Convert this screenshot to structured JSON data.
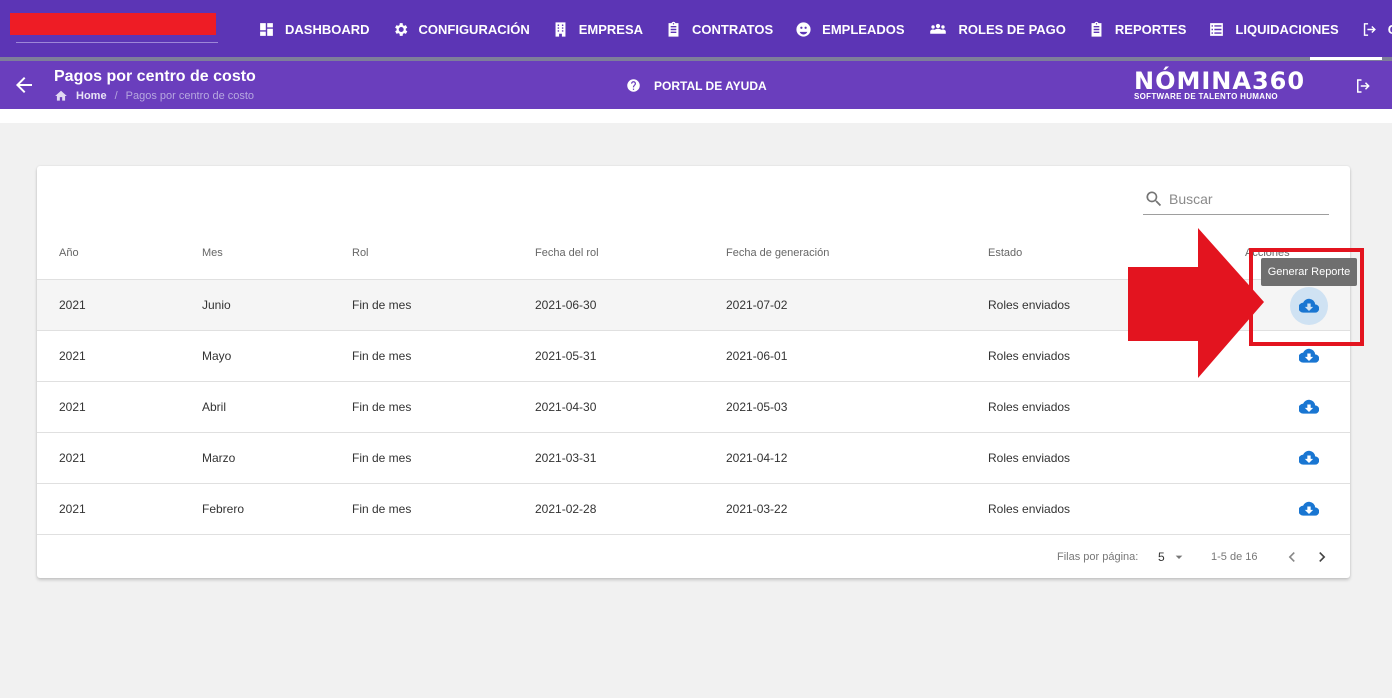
{
  "nav": {
    "items": [
      {
        "label": "DASHBOARD",
        "icon": "dashboard-icon"
      },
      {
        "label": "CONFIGURACIÓN",
        "icon": "gear-icon"
      },
      {
        "label": "EMPRESA",
        "icon": "building-icon"
      },
      {
        "label": "CONTRATOS",
        "icon": "clipboard-icon"
      },
      {
        "label": "EMPLEADOS",
        "icon": "users-icon"
      },
      {
        "label": "ROLES DE PAGO",
        "icon": "group-icon"
      },
      {
        "label": "REPORTES",
        "icon": "report-icon"
      },
      {
        "label": "LIQUIDACIONES",
        "icon": "list-icon"
      },
      {
        "label": "CE",
        "icon": "exit-icon"
      }
    ]
  },
  "header": {
    "title": "Pagos por centro de costo",
    "breadcrumb_home": "Home",
    "breadcrumb_separator": "/",
    "breadcrumb_current": "Pagos por centro de costo",
    "help_label": "PORTAL DE AYUDA",
    "logo_main": "NÓMINA360",
    "logo_sub": "SOFTWARE DE TALENTO HUMANO"
  },
  "search": {
    "placeholder": "Buscar"
  },
  "table": {
    "columns": [
      "Año",
      "Mes",
      "Rol",
      "Fecha del rol",
      "Fecha de generación",
      "Estado",
      "Acciones"
    ],
    "rows": [
      {
        "year": "2021",
        "month": "Junio",
        "rol": "Fin de mes",
        "fecha_rol": "2021-06-30",
        "fecha_gen": "2021-07-02",
        "estado": "Roles enviados"
      },
      {
        "year": "2021",
        "month": "Mayo",
        "rol": "Fin de mes",
        "fecha_rol": "2021-05-31",
        "fecha_gen": "2021-06-01",
        "estado": "Roles enviados"
      },
      {
        "year": "2021",
        "month": "Abril",
        "rol": "Fin de mes",
        "fecha_rol": "2021-04-30",
        "fecha_gen": "2021-05-03",
        "estado": "Roles enviados"
      },
      {
        "year": "2021",
        "month": "Marzo",
        "rol": "Fin de mes",
        "fecha_rol": "2021-03-31",
        "fecha_gen": "2021-04-12",
        "estado": "Roles enviados"
      },
      {
        "year": "2021",
        "month": "Febrero",
        "rol": "Fin de mes",
        "fecha_rol": "2021-02-28",
        "fecha_gen": "2021-03-22",
        "estado": "Roles enviados"
      }
    ]
  },
  "pagination": {
    "rows_per_page_label": "Filas por página:",
    "rows_per_page_value": "5",
    "range": "1-5 de 16"
  },
  "tooltip": {
    "text": "Generar Reporte"
  },
  "colors": {
    "topbar": "#5c35b5",
    "subbar": "#6a3ebd",
    "accent_blue": "#1976d2",
    "annotation_red": "#e3141f"
  }
}
